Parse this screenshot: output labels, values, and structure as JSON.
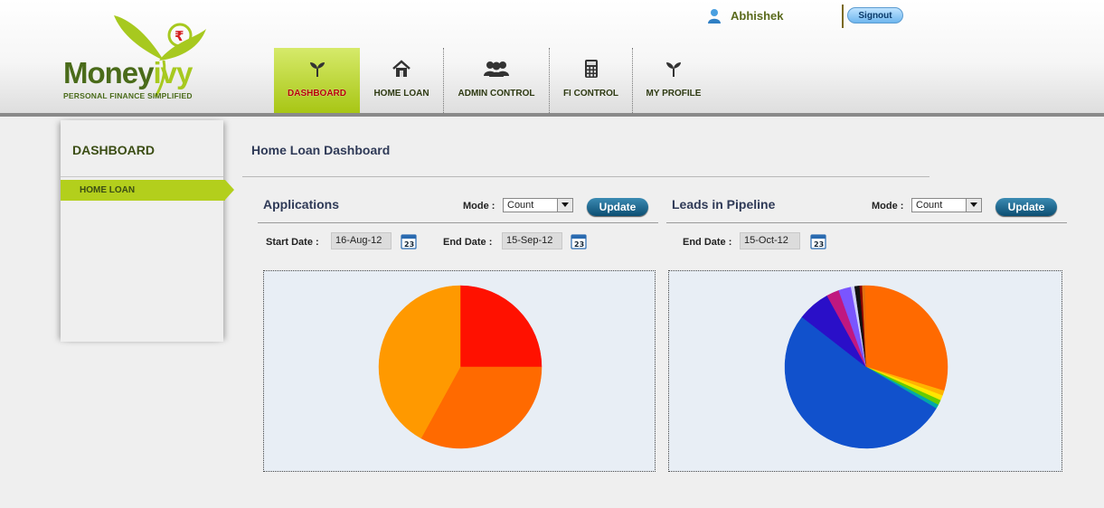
{
  "brand": {
    "name_part1": "Money",
    "name_part2": "ivy",
    "tagline": "PERSONAL FINANCE SIMPLIFIED",
    "colors": {
      "dark_green": "#4a6b1a",
      "light_green": "#a7c91f"
    }
  },
  "header": {
    "user_name": "Abhishek",
    "signout_label": "Signout"
  },
  "nav": {
    "items": [
      {
        "label": "DASHBOARD",
        "icon": "plant-icon",
        "active": true
      },
      {
        "label": "HOME LOAN",
        "icon": "house-icon",
        "active": false
      },
      {
        "label": "ADMIN CONTROL",
        "icon": "users-icon",
        "active": false
      },
      {
        "label": "FI CONTROL",
        "icon": "calculator-icon",
        "active": false
      },
      {
        "label": "MY PROFILE",
        "icon": "plant-icon",
        "active": false
      }
    ]
  },
  "sidebar": {
    "title": "DASHBOARD",
    "items": [
      {
        "label": "HOME LOAN",
        "active": true
      }
    ]
  },
  "main": {
    "page_title": "Home Loan Dashboard",
    "applications": {
      "title": "Applications",
      "mode_label": "Mode :",
      "mode_value": "Count",
      "update_label": "Update",
      "start_date_label": "Start Date :",
      "start_date_value": "16-Aug-12",
      "end_date_label": "End Date :",
      "end_date_value": "15-Sep-12"
    },
    "leads": {
      "title": "Leads in Pipeline",
      "mode_label": "Mode :",
      "mode_value": "Count",
      "update_label": "Update",
      "end_date_label": "End Date :",
      "end_date_value": "15-Oct-12"
    }
  },
  "chart_data": [
    {
      "type": "pie",
      "title": "",
      "slices": [
        {
          "value": 25,
          "color": "#ff1100"
        },
        {
          "value": 33,
          "color": "#ff6a00"
        },
        {
          "value": 42,
          "color": "#ff9900"
        }
      ]
    },
    {
      "type": "pie",
      "title": "",
      "slices": [
        {
          "value": 30.0,
          "color": "#ff6a00"
        },
        {
          "value": 1.0,
          "color": "#ffb300"
        },
        {
          "value": 1.0,
          "color": "#ffe600"
        },
        {
          "value": 1.0,
          "color": "#66cc00"
        },
        {
          "value": 0.8,
          "color": "#00a8a8"
        },
        {
          "value": 52.0,
          "color": "#1151cc"
        },
        {
          "value": 6.5,
          "color": "#2a0fc8"
        },
        {
          "value": 2.5,
          "color": "#c01880"
        },
        {
          "value": 2.5,
          "color": "#7a55ff"
        },
        {
          "value": 0.7,
          "color": "#cfcfff"
        },
        {
          "value": 1.0,
          "color": "#111111"
        },
        {
          "value": 0.5,
          "color": "#8b0000"
        },
        {
          "value": 0.5,
          "color": "#e07010"
        }
      ]
    }
  ]
}
